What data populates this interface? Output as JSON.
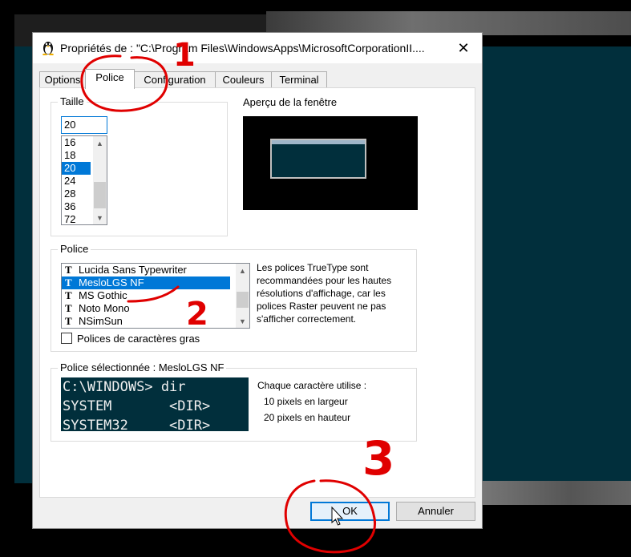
{
  "window": {
    "title": "Propriétés de : \"C:\\Program Files\\WindowsApps\\MicrosoftCorporationII....",
    "close_glyph": "✕",
    "icon": "tux-penguin-icon"
  },
  "tabs": [
    {
      "label": "Options",
      "active": false
    },
    {
      "label": "Police",
      "active": true
    },
    {
      "label": "Configuration",
      "active": false
    },
    {
      "label": "Couleurs",
      "active": false
    },
    {
      "label": "Terminal",
      "active": false
    }
  ],
  "size_group": {
    "label": "Taille",
    "value": "20",
    "items": [
      "16",
      "18",
      "20",
      "24",
      "28",
      "36",
      "72"
    ],
    "selected": "20",
    "scroll_up": "▲",
    "scroll_down": "▼"
  },
  "preview": {
    "label": "Aperçu de la fenêtre"
  },
  "font_group": {
    "label": "Police",
    "items": [
      "Lucida Sans Typewriter",
      "MesloLGS NF",
      "MS Gothic",
      "Noto Mono",
      "NSimSun"
    ],
    "selected": "MesloLGS NF",
    "icon_glyph": "T",
    "note": "Les polices TrueType sont recommandées pour les hautes résolutions d'affichage, car les polices Raster peuvent ne pas s'afficher correctement.",
    "bold_label": "Polices de caractères gras",
    "bold_checked": false
  },
  "selected_font": {
    "label": "Police sélectionnée : MesloLGS NF",
    "sample_lines": [
      "C:\\WINDOWS> dir",
      "SYSTEM       <DIR>",
      "SYSTEM32     <DIR>"
    ],
    "char_info_title": "Chaque caractère utilise :",
    "width_text": "10 pixels en largeur",
    "height_text": "20 pixels en hauteur"
  },
  "buttons": {
    "ok": "OK",
    "cancel": "Annuler"
  },
  "annotations": {
    "n1": "1",
    "n2": "2",
    "n3": "3",
    "color": "#e00000"
  },
  "colors": {
    "accent": "#0078d7",
    "terminal_bg": "#012f3c"
  }
}
